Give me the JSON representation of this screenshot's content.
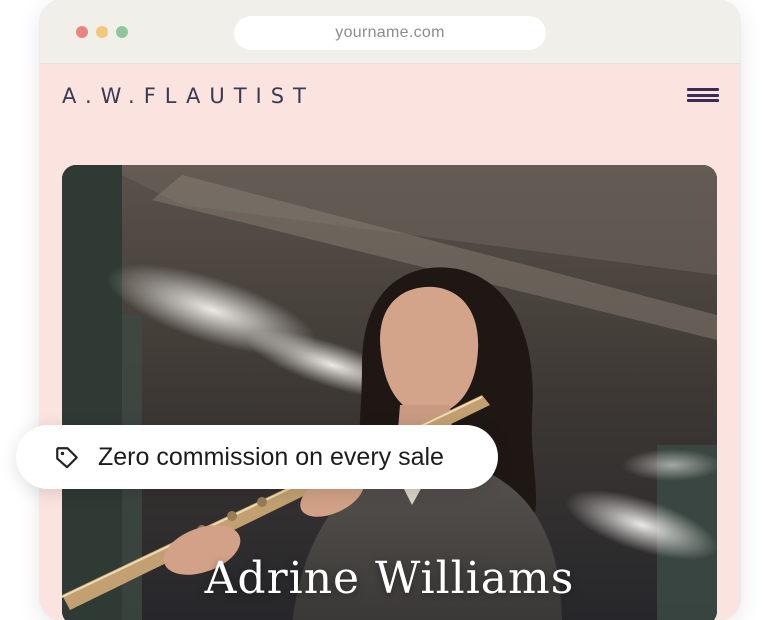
{
  "browser": {
    "url": "yourname.com"
  },
  "site": {
    "logo": "A.W.FLAUTIST",
    "hero_name": "Adrine Williams"
  },
  "badge": {
    "text": "Zero commission on every sale",
    "icon": "tag-icon"
  },
  "colors": {
    "site_background": "#fbe3df",
    "titlebar": "#f1efea",
    "logo_text": "#3a3a52",
    "badge_background": "#ffffff"
  }
}
